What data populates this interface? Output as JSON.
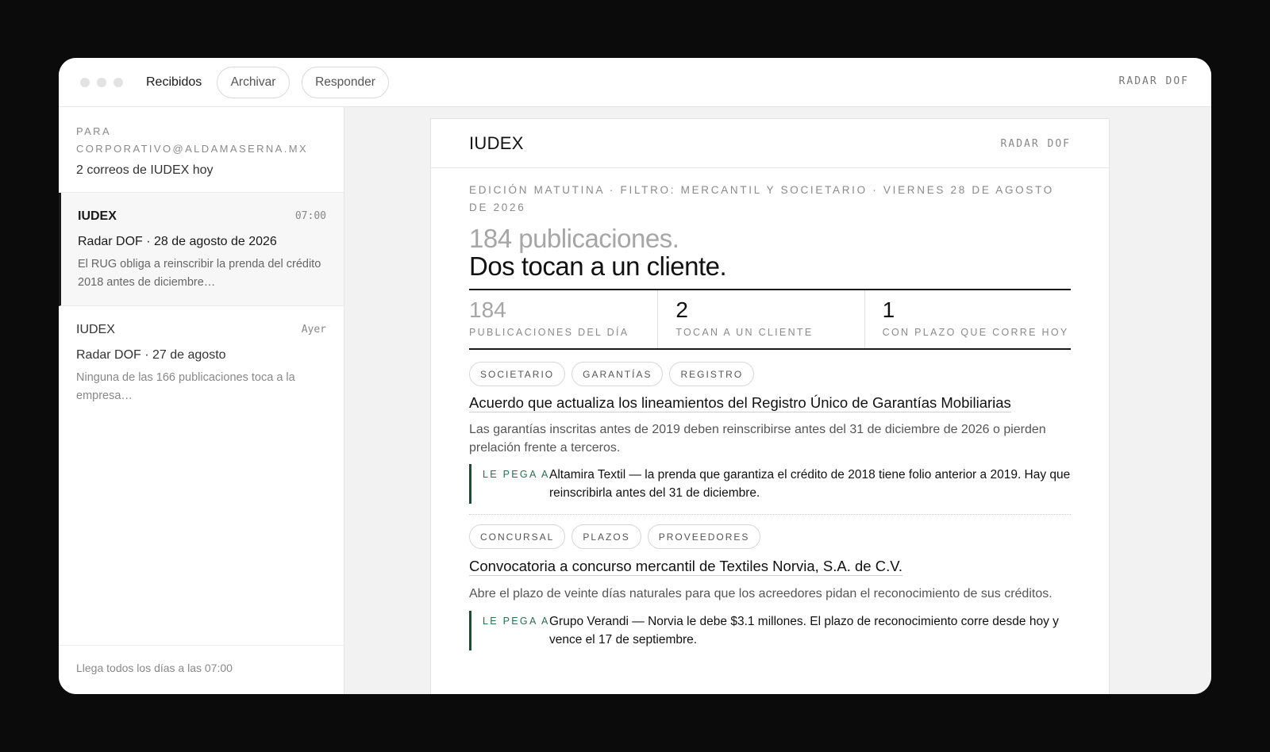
{
  "titlebar": {
    "title": "Recibidos",
    "archive_label": "Archivar",
    "reply_label": "Responder",
    "brand": "RADAR DOF"
  },
  "sidebar": {
    "to_label": "PARA",
    "to_address": "CORPORATIVO@ALDAMASERNA.MX",
    "summary": "2 correos de IUDEX hoy",
    "items": [
      {
        "from": "IUDEX",
        "time": "07:00",
        "subject": "Radar DOF · 28 de agosto de 2026",
        "preview": "El RUG obliga a reinscribir la prenda del crédito 2018 antes de diciembre…"
      },
      {
        "from": "IUDEX",
        "time": "Ayer",
        "subject": "Radar DOF · 27 de agosto",
        "preview": "Ninguna de las 166 publicaciones toca a la empresa…"
      }
    ],
    "footer": "Llega todos los días a las 07:00"
  },
  "email": {
    "logo": "IUDEX",
    "brand": "RADAR DOF",
    "edition": "EDICIÓN MATUTINA · FILTRO: MERCANTIL Y SOCIETARIO · VIERNES 28 DE AGOSTO DE 2026",
    "headline_grey": "184 publicaciones.",
    "headline_dark": "Dos tocan a un cliente.",
    "stats": [
      {
        "value": "184",
        "label": "PUBLICACIONES DEL DÍA"
      },
      {
        "value": "2",
        "label": "TOCAN A UN CLIENTE"
      },
      {
        "value": "1",
        "label": "CON PLAZO QUE CORRE HOY"
      }
    ],
    "items": [
      {
        "tags": [
          "SOCIETARIO",
          "GARANTÍAS",
          "REGISTRO"
        ],
        "title": "Acuerdo que actualiza los lineamientos del Registro Único de Garantías Mobiliarias",
        "description": "Las garantías inscritas antes de 2019 deben reinscribirse antes del 31 de diciembre de 2026 o pierden prelación frente a terceros.",
        "pega_label": "LE PEGA A",
        "pega_text": "Altamira Textil — la prenda que garantiza el crédito de 2018 tiene folio anterior a 2019. Hay que reinscribirla antes del 31 de diciembre."
      },
      {
        "tags": [
          "CONCURSAL",
          "PLAZOS",
          "PROVEEDORES"
        ],
        "title": "Convocatoria a concurso mercantil de Textiles Norvia, S.A. de C.V.",
        "description": "Abre el plazo de veinte días naturales para que los acreedores pidan el reconocimiento de sus créditos.",
        "pega_label": "LE PEGA A",
        "pega_text": "Grupo Verandi — Norvia le debe $3.1 millones. El plazo de reconocimiento corre desde hoy y vence el 17 de septiembre."
      }
    ]
  },
  "colors": {
    "background": "#0b0b0b",
    "accent_green": "#2f6b4f",
    "text_dark": "#111111"
  }
}
